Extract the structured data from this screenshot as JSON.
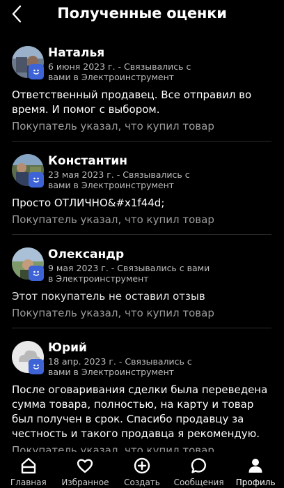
{
  "header": {
    "title": "Полученные оценки"
  },
  "reviews": [
    {
      "name": "Наталья",
      "meta": "6 июня 2023 г. - Связывались с вами в Электроинструмент",
      "text": "Ответственный продавец. Все отправил во время. И помог с выбором.",
      "note": "Покупатель указал, что купил товар"
    },
    {
      "name": "Константин",
      "meta": "23 мая 2023 г. - Связывались с вами в Электроинструмент",
      "text": "Просто ОТЛИЧНО&#x1f44d;",
      "note": "Покупатель указал, что купил товар"
    },
    {
      "name": "Олександр",
      "meta": "9 мая 2023 г. - Связывались с вами в Электроинструмент",
      "text": "Этот покупатель не оставил отзыв",
      "note": "Покупатель указал, что купил товар"
    },
    {
      "name": "Юрий",
      "meta": "18 апр. 2023 г. - Связывались с вами в Электроинструмент",
      "text": "После оговаривания сделки была переведена сумма товара, полностью, на карту и товар был получен в срок. Спасибо продавцу за честность и такого продавца я рекомендую.",
      "note": "Покупатель указал, что купил товар"
    }
  ],
  "navbar": {
    "items": [
      {
        "label": "Главная",
        "icon": "home-icon"
      },
      {
        "label": "Избранное",
        "icon": "heart-icon"
      },
      {
        "label": "Создать",
        "icon": "plus-circle-icon"
      },
      {
        "label": "Сообщения",
        "icon": "chat-icon"
      },
      {
        "label": "Профиль",
        "icon": "user-icon"
      }
    ]
  },
  "colors": {
    "background": "#000000",
    "badge": "#3d63d6",
    "muted_text": "#9c9c9c"
  }
}
